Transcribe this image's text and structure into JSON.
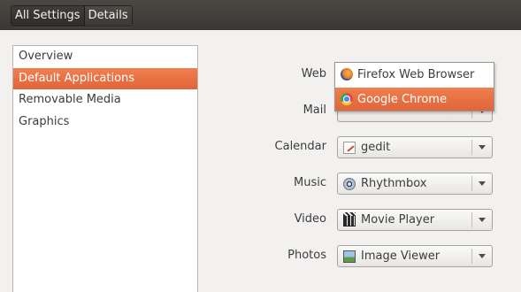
{
  "header": {
    "breadcrumb": [
      "All Settings",
      "Details"
    ]
  },
  "sidebar": {
    "items": [
      {
        "label": "Overview",
        "selected": false
      },
      {
        "label": "Default Applications",
        "selected": true
      },
      {
        "label": "Removable Media",
        "selected": false
      },
      {
        "label": "Graphics",
        "selected": false
      }
    ]
  },
  "defaults": {
    "web": {
      "label": "Web"
    },
    "mail": {
      "label": "Mail"
    },
    "calendar": {
      "label": "Calendar",
      "value": "gedit",
      "icon": "gedit-icon"
    },
    "music": {
      "label": "Music",
      "value": "Rhythmbox",
      "icon": "rhythmbox-icon"
    },
    "video": {
      "label": "Video",
      "value": "Movie Player",
      "icon": "movie-player-icon"
    },
    "photos": {
      "label": "Photos",
      "value": "Image Viewer",
      "icon": "image-viewer-icon"
    }
  },
  "web_dropdown": {
    "options": [
      {
        "label": "Firefox Web Browser",
        "icon": "firefox-icon",
        "highlighted": false
      },
      {
        "label": "Google Chrome",
        "icon": "chrome-icon",
        "highlighted": true
      }
    ]
  },
  "colors": {
    "selection": "#e9703f",
    "header_bg": "#3c3b37",
    "window_bg": "#f2f1f0"
  }
}
